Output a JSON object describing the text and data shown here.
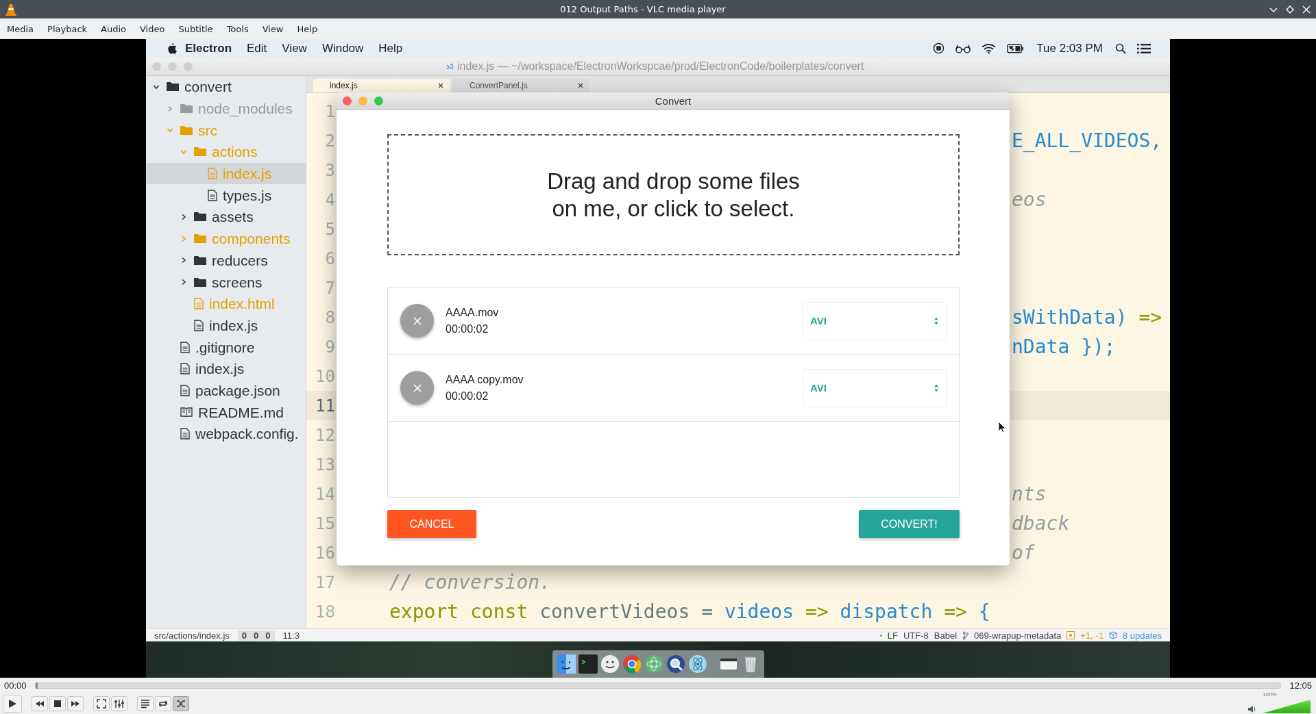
{
  "window": {
    "title": "012 Output Paths - VLC media player"
  },
  "menu": [
    "Media",
    "Playback",
    "Audio",
    "Video",
    "Subtitle",
    "Tools",
    "View",
    "Help"
  ],
  "mac_menubar": {
    "app": "Electron",
    "items": [
      "Edit",
      "View",
      "Window",
      "Help"
    ],
    "clock": "Tue 2:03 PM"
  },
  "editor": {
    "title": "index.js — ~/workspace/ElectronWorkspcae/prod/ElectronCode/boilerplates/convert",
    "tree": [
      {
        "name": "convert",
        "kind": "folder",
        "color": "#333333",
        "expanded": true,
        "selected": false,
        "children": [
          {
            "name": "node_modules",
            "kind": "folder",
            "color": "#999999",
            "expanded": false,
            "selected": false
          },
          {
            "name": "src",
            "kind": "folder",
            "color": "#e3a100",
            "expanded": true,
            "selected": false,
            "children": [
              {
                "name": "actions",
                "kind": "folder",
                "color": "#e3a100",
                "expanded": true,
                "selected": false,
                "children": [
                  {
                    "name": "index.js",
                    "kind": "file",
                    "color": "#e3a100",
                    "selected": true
                  },
                  {
                    "name": "types.js",
                    "kind": "file",
                    "color": "#333333",
                    "selected": false
                  }
                ]
              },
              {
                "name": "assets",
                "kind": "folder",
                "color": "#333333",
                "expanded": false,
                "selected": false
              },
              {
                "name": "components",
                "kind": "folder",
                "color": "#e3a100",
                "expanded": false,
                "selected": false
              },
              {
                "name": "reducers",
                "kind": "folder",
                "color": "#333333",
                "expanded": false,
                "selected": false
              },
              {
                "name": "screens",
                "kind": "folder",
                "color": "#333333",
                "expanded": false,
                "selected": false
              },
              {
                "name": "index.html",
                "kind": "file",
                "color": "#e3a100",
                "selected": false
              },
              {
                "name": "index.js",
                "kind": "file",
                "color": "#333333",
                "selected": false
              }
            ]
          },
          {
            "name": ".gitignore",
            "kind": "file",
            "color": "#333333",
            "selected": false
          },
          {
            "name": "index.js",
            "kind": "file",
            "color": "#333333",
            "selected": false
          },
          {
            "name": "package.json",
            "kind": "file",
            "color": "#333333",
            "selected": false
          },
          {
            "name": "README.md",
            "kind": "readme",
            "color": "#333333",
            "selected": false
          },
          {
            "name": "webpack.config.",
            "kind": "file",
            "color": "#333333",
            "selected": false
          }
        ]
      }
    ],
    "tabs": [
      {
        "label": "index.js",
        "selected": true
      },
      {
        "label": "ConvertPanel.js",
        "selected": false
      }
    ],
    "lines": [
      {
        "number": "1",
        "current": false
      },
      {
        "number": "2",
        "current": false,
        "tokens": [
          {
            "text": "E_ALL_VIDEOS,",
            "kind": "name"
          }
        ]
      },
      {
        "number": "3",
        "current": false
      },
      {
        "number": "4",
        "current": false,
        "tokens": [
          {
            "text": "eos",
            "kind": "comment"
          }
        ]
      },
      {
        "number": "5",
        "current": false
      },
      {
        "number": "6",
        "current": false
      },
      {
        "number": "7",
        "current": false
      },
      {
        "number": "8",
        "current": false,
        "tokens": [
          {
            "text": "sWithData) ",
            "kind": "name"
          },
          {
            "text": "=>",
            "kind": "keyword"
          }
        ]
      },
      {
        "number": "9",
        "current": false,
        "tokens": [
          {
            "text": "nData });",
            "kind": "name"
          }
        ]
      },
      {
        "number": "10",
        "current": false
      },
      {
        "number": "11",
        "current": true
      },
      {
        "number": "12",
        "current": false
      },
      {
        "number": "13",
        "current": false
      },
      {
        "number": "14",
        "current": false,
        "tokens": [
          {
            "text": "nts",
            "kind": "comment"
          }
        ]
      },
      {
        "number": "15",
        "current": false,
        "tokens": [
          {
            "text": "dback",
            "kind": "comment"
          }
        ]
      },
      {
        "number": "16",
        "current": false,
        "tokens": [
          {
            "text": "of",
            "kind": "comment"
          }
        ]
      },
      {
        "number": "17",
        "current": false,
        "tokens": [
          {
            "text": "// conversion.",
            "kind": "comment"
          }
        ]
      },
      {
        "number": "18",
        "current": false,
        "tokens": [
          {
            "text": "export const ",
            "kind": "keyword"
          },
          {
            "text": "convertVideos = ",
            "kind": "plain"
          },
          {
            "text": "videos ",
            "kind": "name"
          },
          {
            "text": "=> ",
            "kind": "keyword"
          },
          {
            "text": "dispatch ",
            "kind": "name"
          },
          {
            "text": "=> ",
            "kind": "keyword"
          },
          {
            "text": "{",
            "kind": "name"
          }
        ]
      }
    ],
    "status_bar": {
      "path": "src/actions/index.js",
      "counters": [
        "0",
        "0",
        "0"
      ],
      "cursor": "11:3",
      "line_ending": "LF",
      "encoding": "UTF-8",
      "grammar": "Babel",
      "branch": "069-wrapup-metadata",
      "diff": "+1, -1",
      "updates": "8 updates"
    }
  },
  "dialog": {
    "title": "Convert",
    "dropzone": "Drag and drop some files\non me, or click to select.",
    "files": [
      {
        "name": "AAAA.mov",
        "duration": "00:00:02",
        "format": "AVI"
      },
      {
        "name": "AAAA copy.mov",
        "duration": "00:00:02",
        "format": "AVI"
      }
    ],
    "buttons": [
      {
        "label": "CANCEL",
        "kind": "cancel"
      },
      {
        "label": "CONVERT!",
        "kind": "primary"
      }
    ]
  },
  "player": {
    "elapsed": "00:00",
    "seek": {
      "level": 0
    },
    "total": "12:05",
    "loop": false,
    "shuffle": true,
    "volume": {
      "label": "100%",
      "level": 1
    }
  }
}
